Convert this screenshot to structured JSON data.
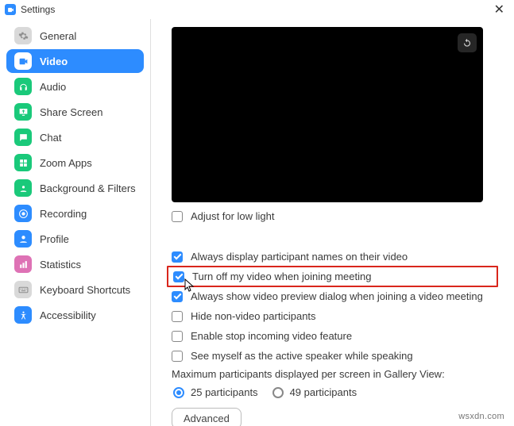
{
  "title": "Settings",
  "sidebar": {
    "items": [
      {
        "label": "General"
      },
      {
        "label": "Video"
      },
      {
        "label": "Audio"
      },
      {
        "label": "Share Screen"
      },
      {
        "label": "Chat"
      },
      {
        "label": "Zoom Apps"
      },
      {
        "label": "Background & Filters"
      },
      {
        "label": "Recording"
      },
      {
        "label": "Profile"
      },
      {
        "label": "Statistics"
      },
      {
        "label": "Keyboard Shortcuts"
      },
      {
        "label": "Accessibility"
      }
    ]
  },
  "video": {
    "adjust_low_light": "Adjust for low light",
    "display_names": "Always display participant names on their video",
    "turn_off_video": "Turn off my video when joining meeting",
    "show_preview": "Always show video preview dialog when joining a video meeting",
    "hide_nonvideo": "Hide non-video participants",
    "enable_stop_incoming": "Enable stop incoming video feature",
    "see_myself_active": "See myself as the active speaker while speaking",
    "max_participants_label": "Maximum participants displayed per screen in Gallery View:",
    "radio_25": "25 participants",
    "radio_49": "49 participants",
    "advanced": "Advanced"
  },
  "watermark": "wsxdn.com"
}
